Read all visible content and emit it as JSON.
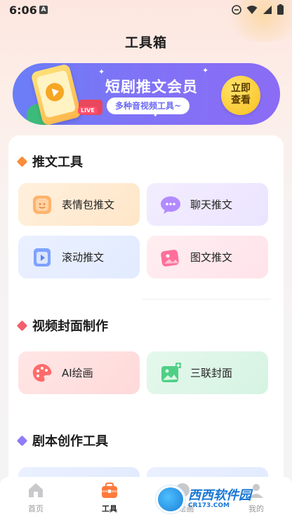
{
  "status": {
    "time": "6:06",
    "app_badge": "A"
  },
  "page": {
    "title": "工具箱"
  },
  "banner": {
    "title": "短剧推文会员",
    "subtitle": "多种音视频工具~",
    "cta_line1": "立即",
    "cta_line2": "查看",
    "phone_tag": "LIVE"
  },
  "sections": [
    {
      "title": "推文工具",
      "accent": "#fb8c3a",
      "tiles": [
        {
          "label": "表情包推文",
          "icon": "emoji-face-icon"
        },
        {
          "label": "聊天推文",
          "icon": "chat-bubble-icon"
        },
        {
          "label": "滚动推文",
          "icon": "scroll-play-icon"
        },
        {
          "label": "图文推文",
          "icon": "image-text-icon"
        }
      ]
    },
    {
      "title": "视频封面制作",
      "accent": "#f2606b",
      "tiles": [
        {
          "label": "AI绘画",
          "icon": "palette-icon"
        },
        {
          "label": "三联封面",
          "icon": "picture-add-icon"
        }
      ]
    },
    {
      "title": "剧本创作工具",
      "accent": "#8f7cf6",
      "tiles": []
    }
  ],
  "nav": {
    "items": [
      {
        "label": "首页",
        "icon": "home-icon",
        "active": false
      },
      {
        "label": "工具",
        "icon": "toolbox-icon",
        "active": true
      },
      {
        "label": "AI绘画",
        "icon": "ai-paint-icon",
        "active": false
      },
      {
        "label": "我的",
        "icon": "profile-icon",
        "active": false
      }
    ]
  },
  "watermark": {
    "title": "西西软件园",
    "domain": "CR173.COM"
  }
}
